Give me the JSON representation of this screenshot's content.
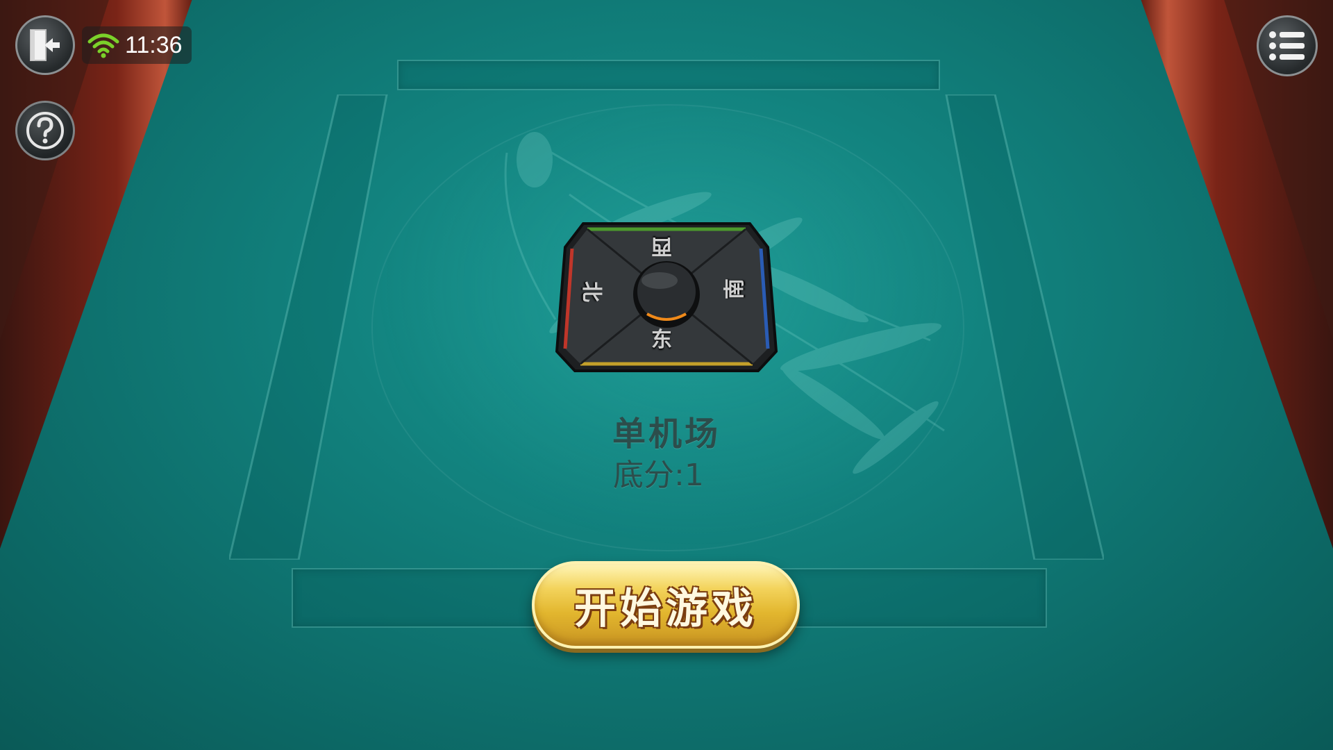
{
  "status_bar": {
    "time": "11:36"
  },
  "table": {
    "compass": {
      "west": "西",
      "south": "南",
      "north": "北",
      "east": "东"
    },
    "mode_title": "单机场",
    "base_score": "底分:1"
  },
  "start_button": {
    "label": "开始游戏"
  },
  "icons": {
    "exit": "exit-door-icon",
    "help": "question-icon",
    "wifi": "wifi-icon",
    "menu": "list-menu-icon"
  },
  "colors": {
    "felt": "#12827e",
    "rail_wood": "#7a2417",
    "button_gold": "#e2b62e",
    "label_text": "#2c4d4b",
    "wifi_green": "#7bd12a"
  }
}
